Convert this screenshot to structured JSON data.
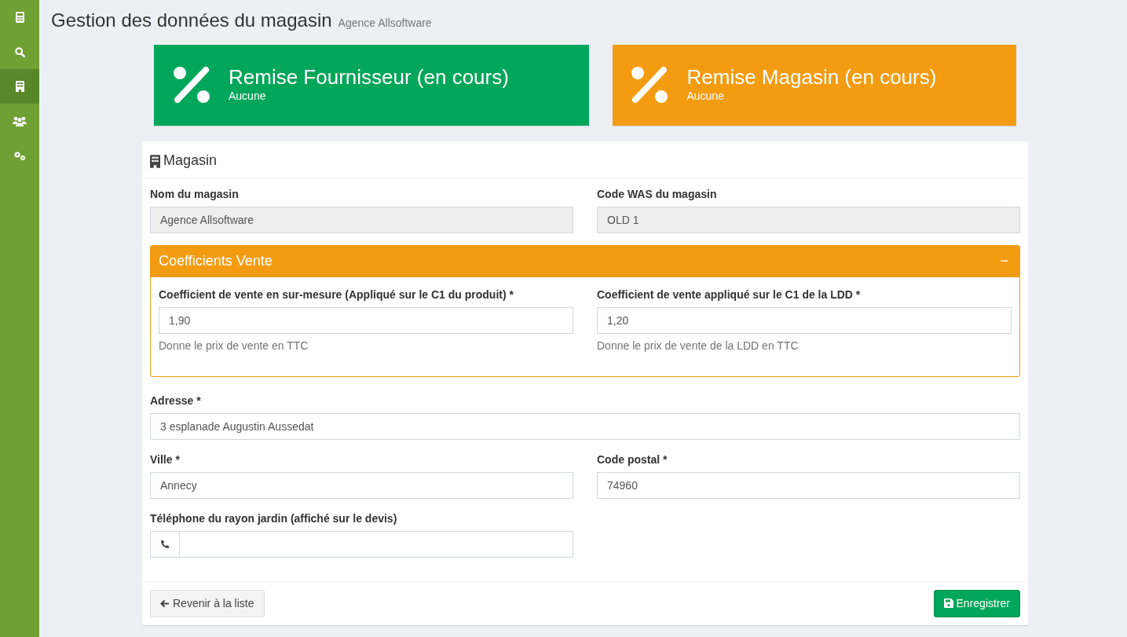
{
  "sidebar": {
    "items": [
      {
        "selected": false
      },
      {
        "selected": false
      },
      {
        "selected": true
      },
      {
        "selected": false
      },
      {
        "selected": false
      }
    ]
  },
  "header": {
    "title": "Gestion des données du magasin",
    "subtitle": "Agence Allsoftware"
  },
  "info_boxes": [
    {
      "title": "Remise Fournisseur (en cours)",
      "value": "Aucune",
      "color": "#00a65a"
    },
    {
      "title": "Remise Magasin (en cours)",
      "value": "Aucune",
      "color": "#f39c12"
    }
  ],
  "panel": {
    "title": "Magasin",
    "sections": [
      {
        "kind": "fields",
        "fields": [
          {
            "label": "Nom du magasin",
            "value": "Agence Allsoftware",
            "readonly": true,
            "kind": "text"
          },
          {
            "label": "Code WAS du magasin",
            "value": "OLD 1",
            "readonly": true,
            "kind": "text"
          }
        ]
      },
      {
        "kind": "collapsible",
        "title": "Coefficients Vente",
        "toggle": "−",
        "expanded": true,
        "fields": [
          {
            "label": "Coefficient de vente en sur-mesure (Appliqué sur le C1 du produit) *",
            "value": "1,90",
            "readonly": false,
            "kind": "text",
            "help": "Donne le prix de vente en TTC"
          },
          {
            "label": "Coefficient de vente appliqué sur le C1 de la LDD *",
            "value": "1,20",
            "readonly": false,
            "kind": "text",
            "help": "Donne le prix de vente de la LDD en TTC"
          }
        ]
      },
      {
        "kind": "fields",
        "fields": [
          {
            "label": "Adresse *",
            "value": "3 esplanade Augustin Aussedat",
            "readonly": false,
            "kind": "text"
          }
        ]
      },
      {
        "kind": "fields",
        "fields": [
          {
            "label": "Ville *",
            "value": "Annecy",
            "readonly": false,
            "kind": "text"
          },
          {
            "label": "Code postal *",
            "value": "74960",
            "readonly": false,
            "kind": "text"
          }
        ]
      },
      {
        "kind": "fields",
        "fields": [
          {
            "label": "Téléphone du rayon jardin (affiché sur le devis)",
            "readonly": false,
            "kind": "phone"
          }
        ]
      }
    ],
    "footer": {
      "back_button": "Revenir à la liste",
      "save_button": "Enregistrer"
    }
  }
}
